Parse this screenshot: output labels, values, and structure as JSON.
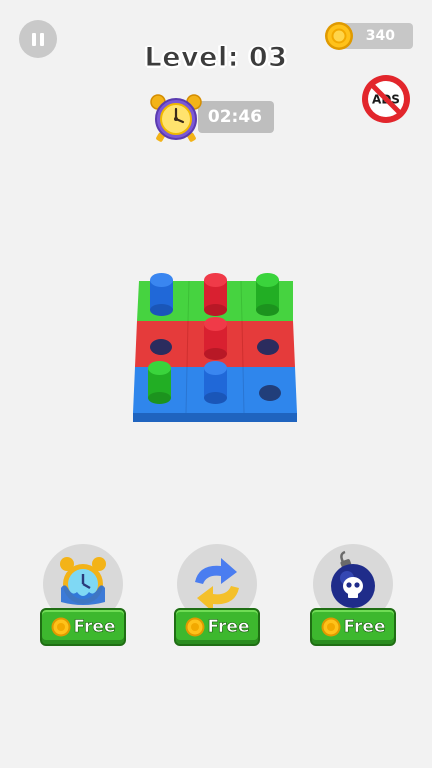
{
  "hud": {
    "coins": "340",
    "level_label": "Level: 03",
    "timer": "02:46",
    "no_ads_text": "ADS"
  },
  "board": {
    "rows": [
      {
        "color": "#46d340",
        "pegs": [
          "blue",
          "red",
          "green"
        ]
      },
      {
        "color": "#e53b3b",
        "pegs": [
          "hole",
          "red",
          "hole"
        ]
      },
      {
        "color": "#2f86ec",
        "pegs": [
          "green",
          "blue",
          "hole"
        ]
      }
    ],
    "peg_colors": {
      "blue": "#2a74e0",
      "red": "#e52a34",
      "green": "#29c22b"
    }
  },
  "boosters": [
    {
      "name": "time-freeze",
      "label": "Free"
    },
    {
      "name": "shuffle",
      "label": "Free"
    },
    {
      "name": "bomb",
      "label": "Free"
    }
  ],
  "colors": {
    "background": "#f2f2f2",
    "free_button": "#3db82e",
    "coin": "#f5b800"
  }
}
